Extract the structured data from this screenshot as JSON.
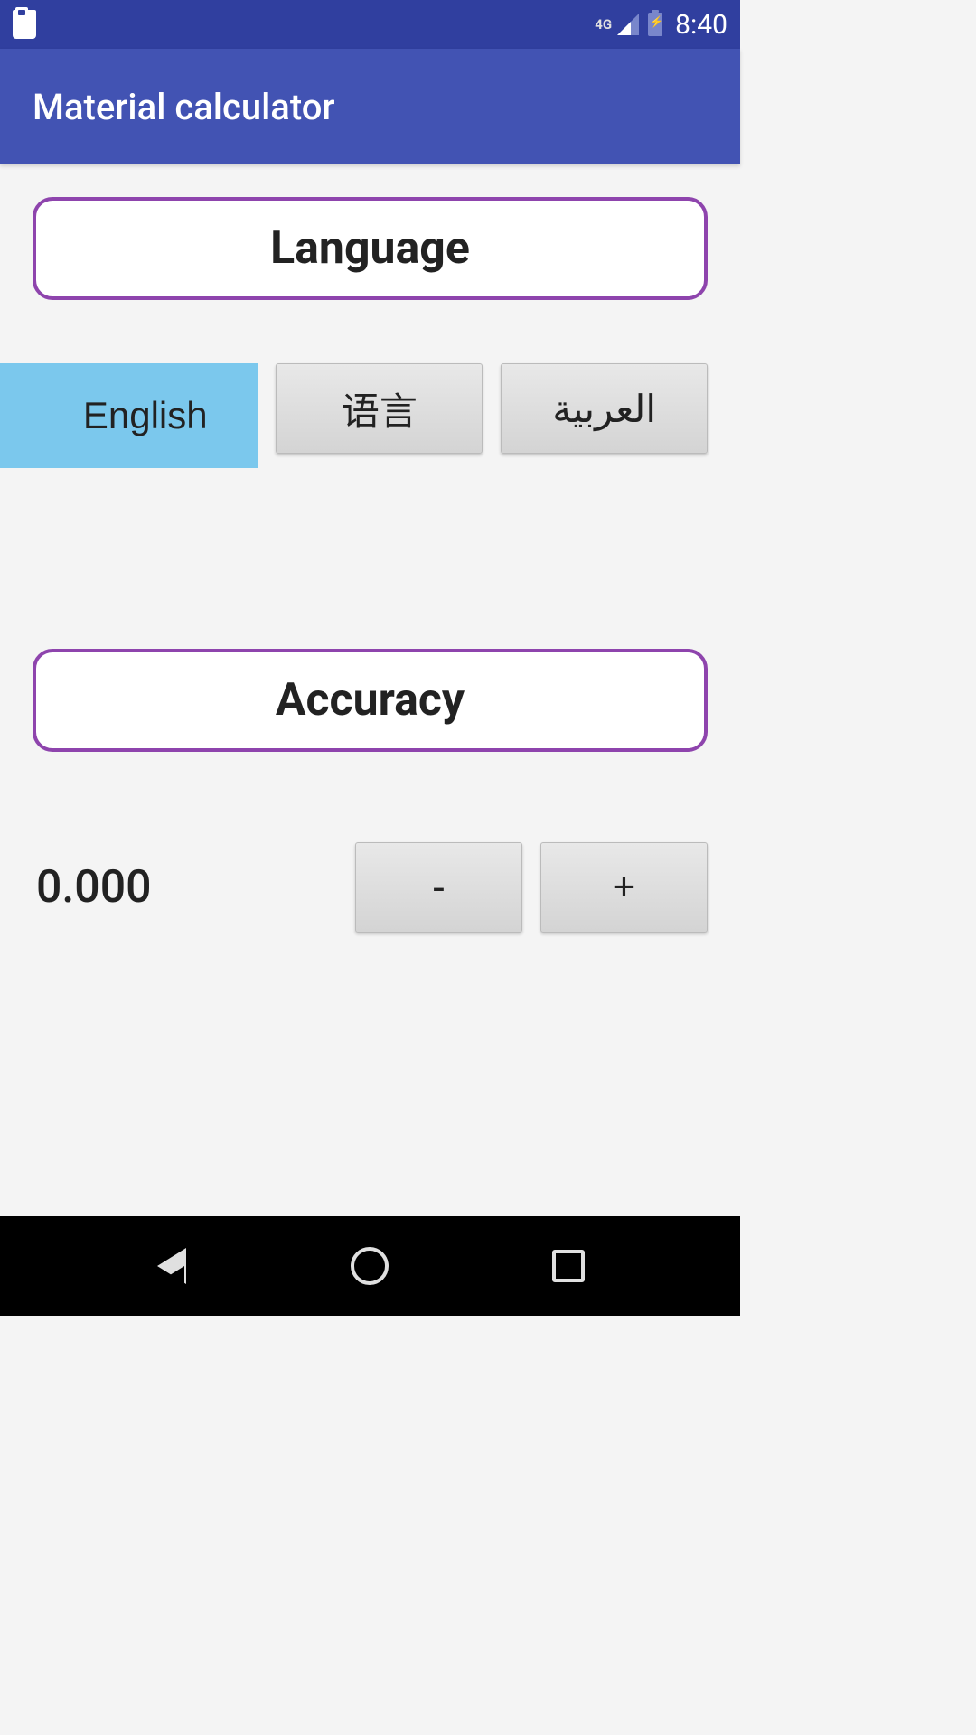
{
  "status": {
    "network": "4G",
    "time": "8:40"
  },
  "app": {
    "title": "Material calculator"
  },
  "sections": {
    "language": {
      "title": "Language",
      "options": [
        {
          "label": "English",
          "selected": true
        },
        {
          "label": "语言",
          "selected": false
        },
        {
          "label": "العربية",
          "selected": false
        }
      ]
    },
    "accuracy": {
      "title": "Accuracy",
      "value": "0.000",
      "decrease": "-",
      "increase": "+"
    }
  }
}
